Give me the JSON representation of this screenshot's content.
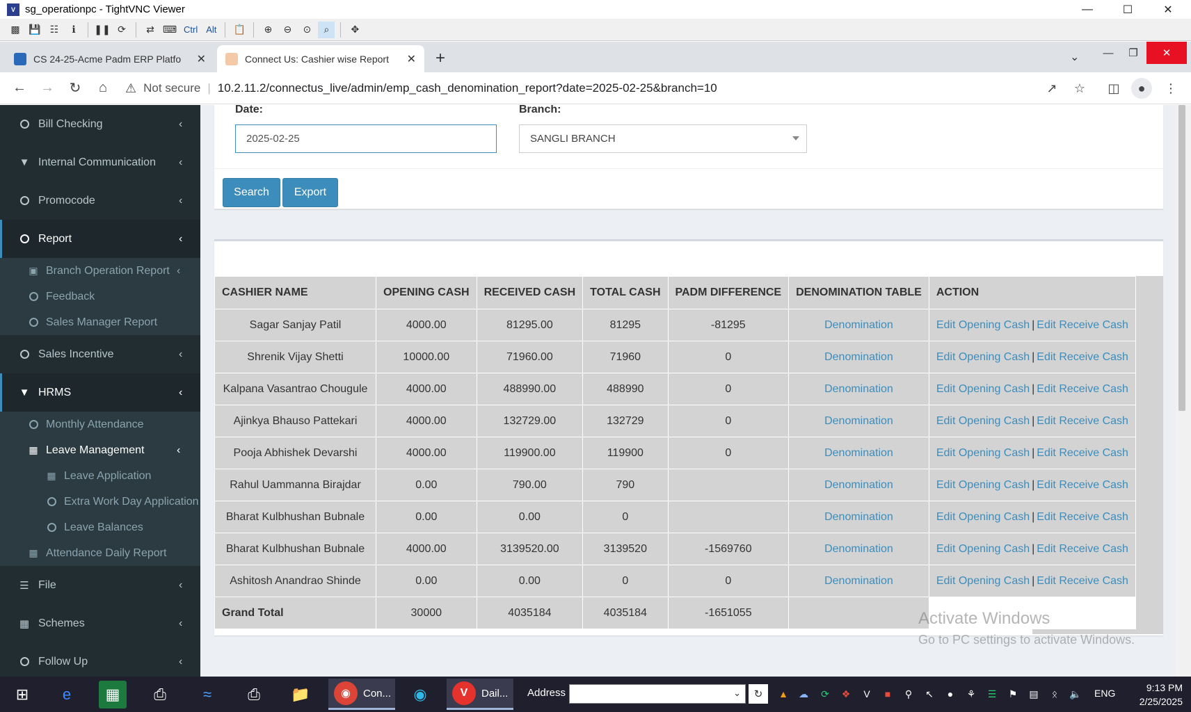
{
  "vnc": {
    "title": "sg_operationpc - TightVNC Viewer",
    "toolbar_ctrl": "Ctrl",
    "toolbar_alt": "Alt"
  },
  "browser": {
    "tabs": [
      {
        "label": "CS 24-25-Acme Padm ERP Platfo",
        "active": false
      },
      {
        "label": "Connect Us: Cashier wise Report",
        "active": true
      }
    ],
    "security": "Not secure",
    "url": "10.2.11.2/connectus_live/admin/emp_cash_denomination_report?date=2025-02-25&branch=10"
  },
  "sidebar": {
    "items": [
      {
        "label": "Bill Checking",
        "icon": "circle-icon"
      },
      {
        "label": "Internal Communication",
        "icon": "filter-icon"
      },
      {
        "label": "Promocode",
        "icon": "circle-icon"
      },
      {
        "label": "Report",
        "icon": "circle-icon"
      },
      {
        "label": "Sales Incentive",
        "icon": "circle-icon"
      },
      {
        "label": "HRMS",
        "icon": "filter-icon"
      },
      {
        "label": "File",
        "icon": "database-icon"
      },
      {
        "label": "Schemes",
        "icon": "table-icon"
      },
      {
        "label": "Follow Up",
        "icon": "circle-icon"
      }
    ],
    "report_sub": [
      {
        "label": "Branch Operation Report",
        "icon": "money-icon"
      },
      {
        "label": "Feedback",
        "icon": "circle-icon"
      },
      {
        "label": "Sales Manager Report",
        "icon": "circle-icon"
      }
    ],
    "hrms_sub": [
      {
        "label": "Monthly Attendance",
        "icon": "circle-icon"
      },
      {
        "label": "Leave Management",
        "icon": "table-icon"
      },
      {
        "label": "Attendance Daily Report",
        "icon": "table-icon"
      }
    ],
    "leave_sub": [
      {
        "label": "Leave Application",
        "icon": "table-icon"
      },
      {
        "label": "Extra Work Day Application",
        "icon": "circle-icon"
      },
      {
        "label": "Leave Balances",
        "icon": "circle-icon"
      }
    ]
  },
  "filters": {
    "date_label": "Date:",
    "date_value": "2025-02-25",
    "branch_label": "Branch:",
    "branch_value": "SANGLI BRANCH",
    "search_label": "Search",
    "export_label": "Export"
  },
  "table": {
    "headers": [
      "CASHIER NAME",
      "OPENING CASH",
      "RECEIVED CASH",
      "TOTAL CASH",
      "PADM DIFFERENCE",
      "DENOMINATION TABLE",
      "ACTION"
    ],
    "link_denomination": "Denomination",
    "link_edit_opening": "Edit Opening Cash",
    "link_separator": "|",
    "link_edit_receive": "Edit Receive Cash",
    "rows": [
      {
        "name": "Sagar Sanjay Patil",
        "opening": "4000.00",
        "received": "81295.00",
        "total": "81295",
        "diff": "-81295"
      },
      {
        "name": "Shrenik Vijay Shetti",
        "opening": "10000.00",
        "received": "71960.00",
        "total": "71960",
        "diff": "0"
      },
      {
        "name": "Kalpana Vasantrao Chougule",
        "opening": "4000.00",
        "received": "488990.00",
        "total": "488990",
        "diff": "0"
      },
      {
        "name": "Ajinkya Bhauso Pattekari",
        "opening": "4000.00",
        "received": "132729.00",
        "total": "132729",
        "diff": "0"
      },
      {
        "name": "Pooja Abhishek Devarshi",
        "opening": "4000.00",
        "received": "119900.00",
        "total": "119900",
        "diff": "0"
      },
      {
        "name": "Rahul Uammanna Birajdar",
        "opening": "0.00",
        "received": "790.00",
        "total": "790",
        "diff": ""
      },
      {
        "name": "Bharat Kulbhushan Bubnale",
        "opening": "0.00",
        "received": "0.00",
        "total": "0",
        "diff": ""
      },
      {
        "name": "Bharat Kulbhushan Bubnale",
        "opening": "4000.00",
        "received": "3139520.00",
        "total": "3139520",
        "diff": "-1569760"
      },
      {
        "name": "Ashitosh Anandrao Shinde",
        "opening": "0.00",
        "received": "0.00",
        "total": "0",
        "diff": "0"
      }
    ],
    "total_row": {
      "label": "Grand Total",
      "opening": "30000",
      "received": "4035184",
      "total": "4035184",
      "diff": "-1651055"
    }
  },
  "watermark": {
    "line1": "Activate Windows",
    "line2": "Go to PC settings to activate Windows."
  },
  "taskbar": {
    "chrome_label": "Con...",
    "vivaldi_label": "Dail...",
    "address_label": "Address",
    "lang": "ENG",
    "time": "9:13 PM",
    "date": "2/25/2025"
  },
  "colors": {
    "sidebar_bg": "#222d32",
    "accent": "#3c8dbc",
    "table_bg": "#d3d3d3",
    "taskbar_bg": "#1f1f2e"
  }
}
